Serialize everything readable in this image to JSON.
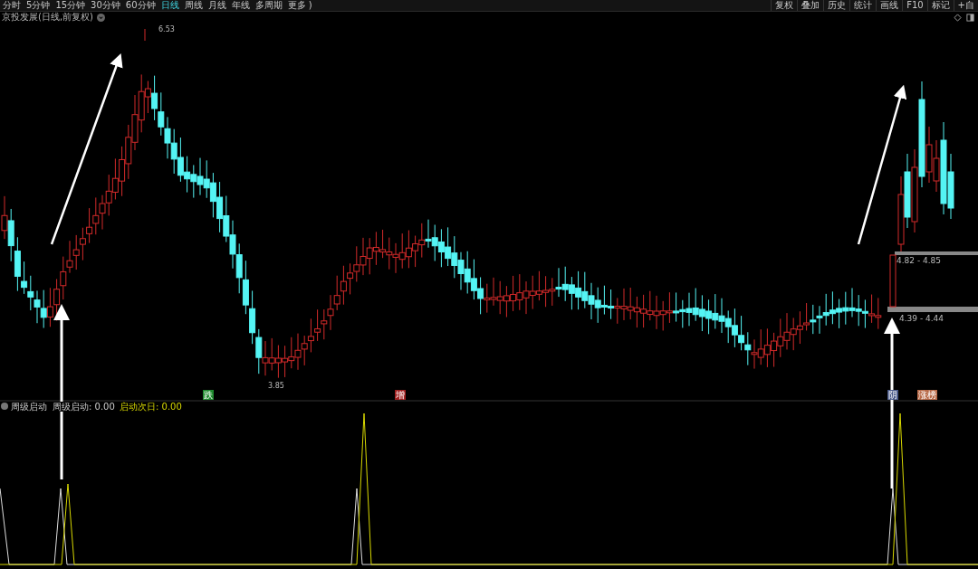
{
  "toolbar": {
    "periods": [
      {
        "label": "分时",
        "selected": false
      },
      {
        "label": "5分钟",
        "selected": false
      },
      {
        "label": "15分钟",
        "selected": false
      },
      {
        "label": "30分钟",
        "selected": false
      },
      {
        "label": "60分钟",
        "selected": false
      },
      {
        "label": "日线",
        "selected": true
      },
      {
        "label": "周线",
        "selected": false
      },
      {
        "label": "月线",
        "selected": false
      },
      {
        "label": "年线",
        "selected": false
      },
      {
        "label": "多周期",
        "selected": false
      },
      {
        "label": "更多 )",
        "selected": false
      }
    ],
    "buttons": [
      "复权",
      "叠加",
      "历史",
      "统计",
      "画线",
      "F10",
      "标记",
      "+自"
    ]
  },
  "chart": {
    "title": "京投发展(日线,前复权)",
    "high_label": "6.53",
    "low_label": "3.85",
    "range_labels": [
      "4.82 - 4.85",
      "4.39 - 4.44"
    ],
    "signals": [
      {
        "label": "跌",
        "color": "#1e8a2e"
      },
      {
        "label": "增",
        "color": "#a02020"
      },
      {
        "label": "阴",
        "color": "#4a5a8a"
      },
      {
        "label": "涨榜",
        "color": "#b86a48"
      }
    ]
  },
  "indicator": {
    "name": "周级启动",
    "values": [
      {
        "text": "周级启动: 0.00",
        "kind": "plain"
      },
      {
        "text": "启动次日: 0.00",
        "kind": "highlight"
      }
    ]
  }
}
